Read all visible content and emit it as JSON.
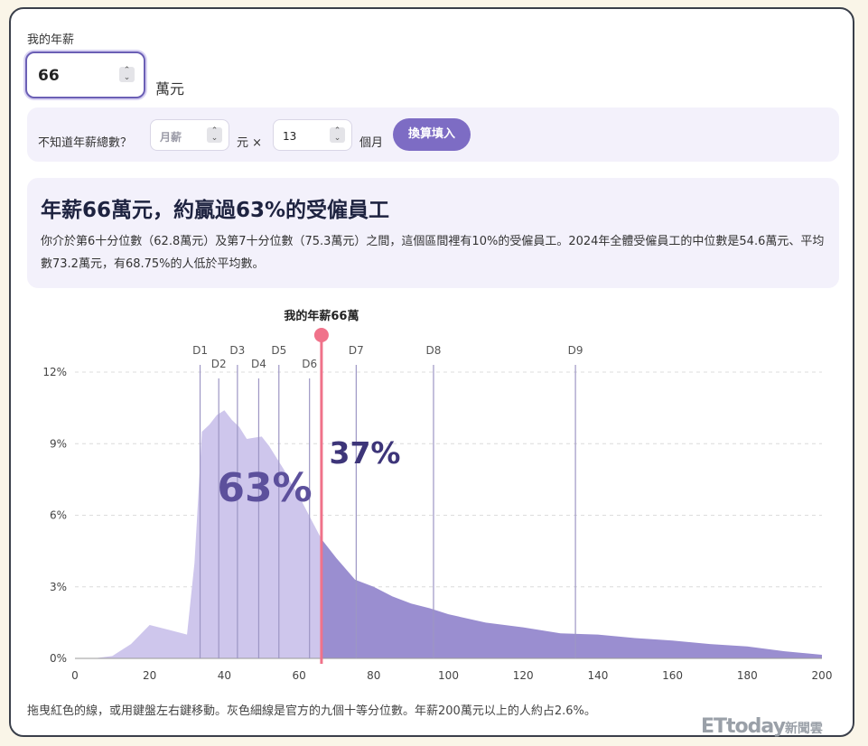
{
  "form": {
    "salary_label": "我的年薪",
    "salary_value": "66",
    "unit": "萬元"
  },
  "calculator": {
    "question": "不知道年薪總數？",
    "monthly_placeholder": "月薪",
    "yuan_times": "元 ×",
    "months_value": "13",
    "months_unit": "個月",
    "button": "換算填入"
  },
  "result": {
    "headline": "年薪66萬元，約贏過63%的受僱員工",
    "description": "你介於第6十分位數（62.8萬元）及第7十分位數（75.3萬元）之間，這個區間裡有10%的受僱員工。2024年全體受僱員工的中位數是54.6萬元、平均數73.2萬元，有68.75%的人低於平均數。"
  },
  "chart_data": {
    "type": "area",
    "xlim": [
      0,
      200
    ],
    "ylim": [
      0,
      12
    ],
    "x_ticks": [
      "0",
      "20",
      "40",
      "60",
      "80",
      "100",
      "120",
      "140",
      "160",
      "180",
      "200"
    ],
    "y_ticks": [
      "0%",
      "3%",
      "6%",
      "9%",
      "12%"
    ],
    "grid": true,
    "x": [
      0,
      5,
      10,
      15,
      20,
      25,
      30,
      32,
      34,
      36,
      38,
      40,
      42,
      44,
      46,
      48,
      50,
      52,
      54,
      56,
      58,
      60,
      62,
      64,
      66,
      70,
      75,
      80,
      85,
      90,
      95,
      100,
      110,
      120,
      130,
      140,
      150,
      160,
      170,
      180,
      190,
      200
    ],
    "y": [
      0,
      0,
      0.1,
      0.6,
      1.4,
      1.2,
      1.0,
      4.0,
      9.5,
      9.8,
      10.2,
      10.4,
      10.0,
      9.7,
      9.2,
      9.25,
      9.3,
      8.9,
      8.4,
      7.9,
      7.3,
      6.8,
      6.2,
      5.6,
      5.0,
      4.2,
      3.3,
      3.0,
      2.6,
      2.3,
      2.1,
      1.85,
      1.5,
      1.3,
      1.05,
      1.0,
      0.85,
      0.75,
      0.6,
      0.5,
      0.3,
      0.15
    ],
    "marker": {
      "x": 66,
      "label": "我的年薪66萬"
    },
    "left_pct": "63%",
    "right_pct": "37%",
    "deciles": [
      {
        "label": "D1",
        "x": 33.5
      },
      {
        "label": "D2",
        "x": 38.5
      },
      {
        "label": "D3",
        "x": 43.5
      },
      {
        "label": "D4",
        "x": 49.2
      },
      {
        "label": "D5",
        "x": 54.6
      },
      {
        "label": "D6",
        "x": 62.8
      },
      {
        "label": "D7",
        "x": 75.3
      },
      {
        "label": "D8",
        "x": 96
      },
      {
        "label": "D9",
        "x": 134
      }
    ],
    "colors": {
      "left_fill": "#cec6ec",
      "right_fill": "#9a8ed0",
      "marker": "#f0728a",
      "decile": "#9d96c4",
      "pct_text": "#3d3579"
    }
  },
  "footnote": "拖曳紅色的線，或用鍵盤左右鍵移動。灰色細線是官方的九個十等分位數。年薪200萬元以上的人約占2.6%。",
  "watermark": {
    "brand": "ETtoday",
    "suffix": "新聞雲"
  }
}
